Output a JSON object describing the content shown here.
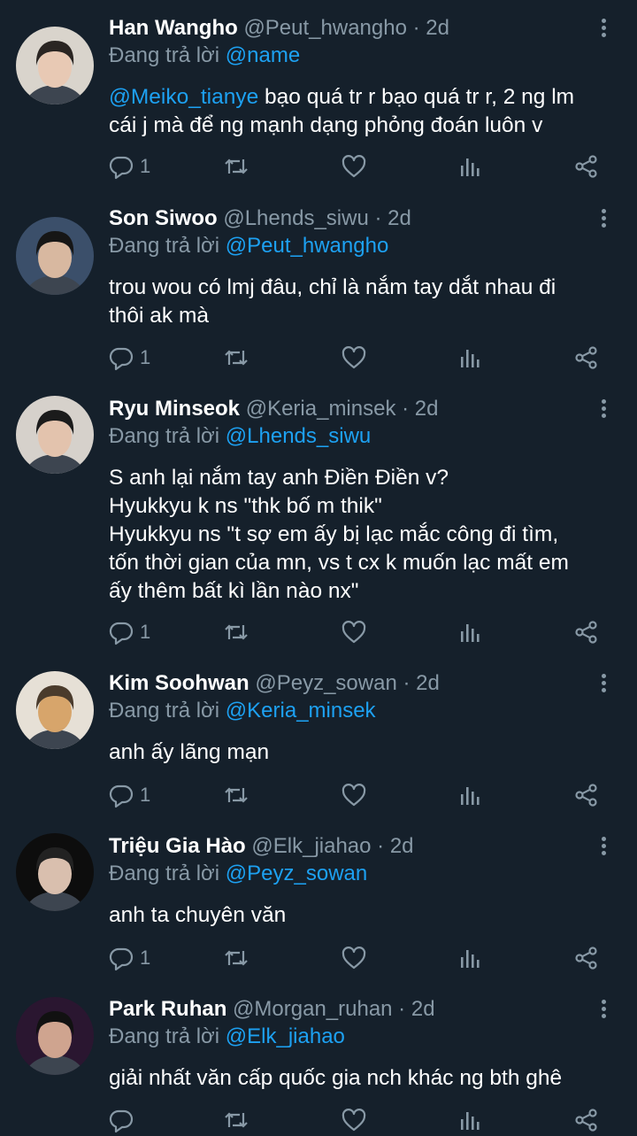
{
  "colors": {
    "background": "#15202b",
    "text": "#ffffff",
    "secondary": "#8899a6",
    "accent": "#1da1f2"
  },
  "replying_prefix": "Đang trả lời",
  "tweets": [
    {
      "name": "Han Wangho",
      "handle": "@Peut_hwangho",
      "time": "2d",
      "replying_to": "@name",
      "mention": "@Meiko_tianye",
      "lines": [
        " bạo quá tr r bạo quá tr r, 2 ng lm",
        "cái j mà để ng mạnh dạng phỏng đoán luôn v"
      ],
      "reply_count": "1",
      "avatar_icon": "user-avatar"
    },
    {
      "name": "Son Siwoo",
      "handle": "@Lhends_siwu",
      "time": "2d",
      "replying_to": "@Peut_hwangho",
      "lines": [
        "trou wou có lmj đâu, chỉ là nắm tay dắt nhau đi",
        "thôi ak mà"
      ],
      "reply_count": "1",
      "avatar_icon": "user-avatar"
    },
    {
      "name": "Ryu Minseok",
      "handle": "@Keria_minsek",
      "time": "2d",
      "replying_to": "@Lhends_siwu",
      "lines": [
        "S anh lại nắm tay anh Điền Điền v?",
        "Hyukkyu k ns \"thk bố m thik\"",
        "Hyukkyu ns \"t sợ em ấy bị lạc mắc công đi tìm,",
        "tốn thời gian của mn, vs t cx k muốn lạc mất em",
        "ấy thêm bất kì lần nào nx\""
      ],
      "reply_count": "1",
      "avatar_icon": "user-avatar"
    },
    {
      "name": "Kim Soohwan",
      "handle": "@Peyz_sowan",
      "time": "2d",
      "replying_to": "@Keria_minsek",
      "lines": [
        "anh ấy lãng mạn"
      ],
      "reply_count": "1",
      "avatar_icon": "user-avatar"
    },
    {
      "name": "Triệu Gia Hào",
      "handle": "@Elk_jiahao",
      "time": "2d",
      "replying_to": "@Peyz_sowan",
      "lines": [
        "anh ta chuyên văn"
      ],
      "reply_count": "1",
      "avatar_icon": "user-avatar"
    },
    {
      "name": "Park Ruhan",
      "handle": "@Morgan_ruhan",
      "time": "2d",
      "replying_to": "@Elk_jiahao",
      "lines": [
        "giải nhất văn cấp quốc gia nch khác ng bth ghê"
      ],
      "reply_count": "",
      "avatar_icon": "user-avatar"
    }
  ],
  "action_icons": [
    "reply-icon",
    "retweet-icon",
    "like-icon",
    "analytics-icon",
    "share-icon"
  ]
}
